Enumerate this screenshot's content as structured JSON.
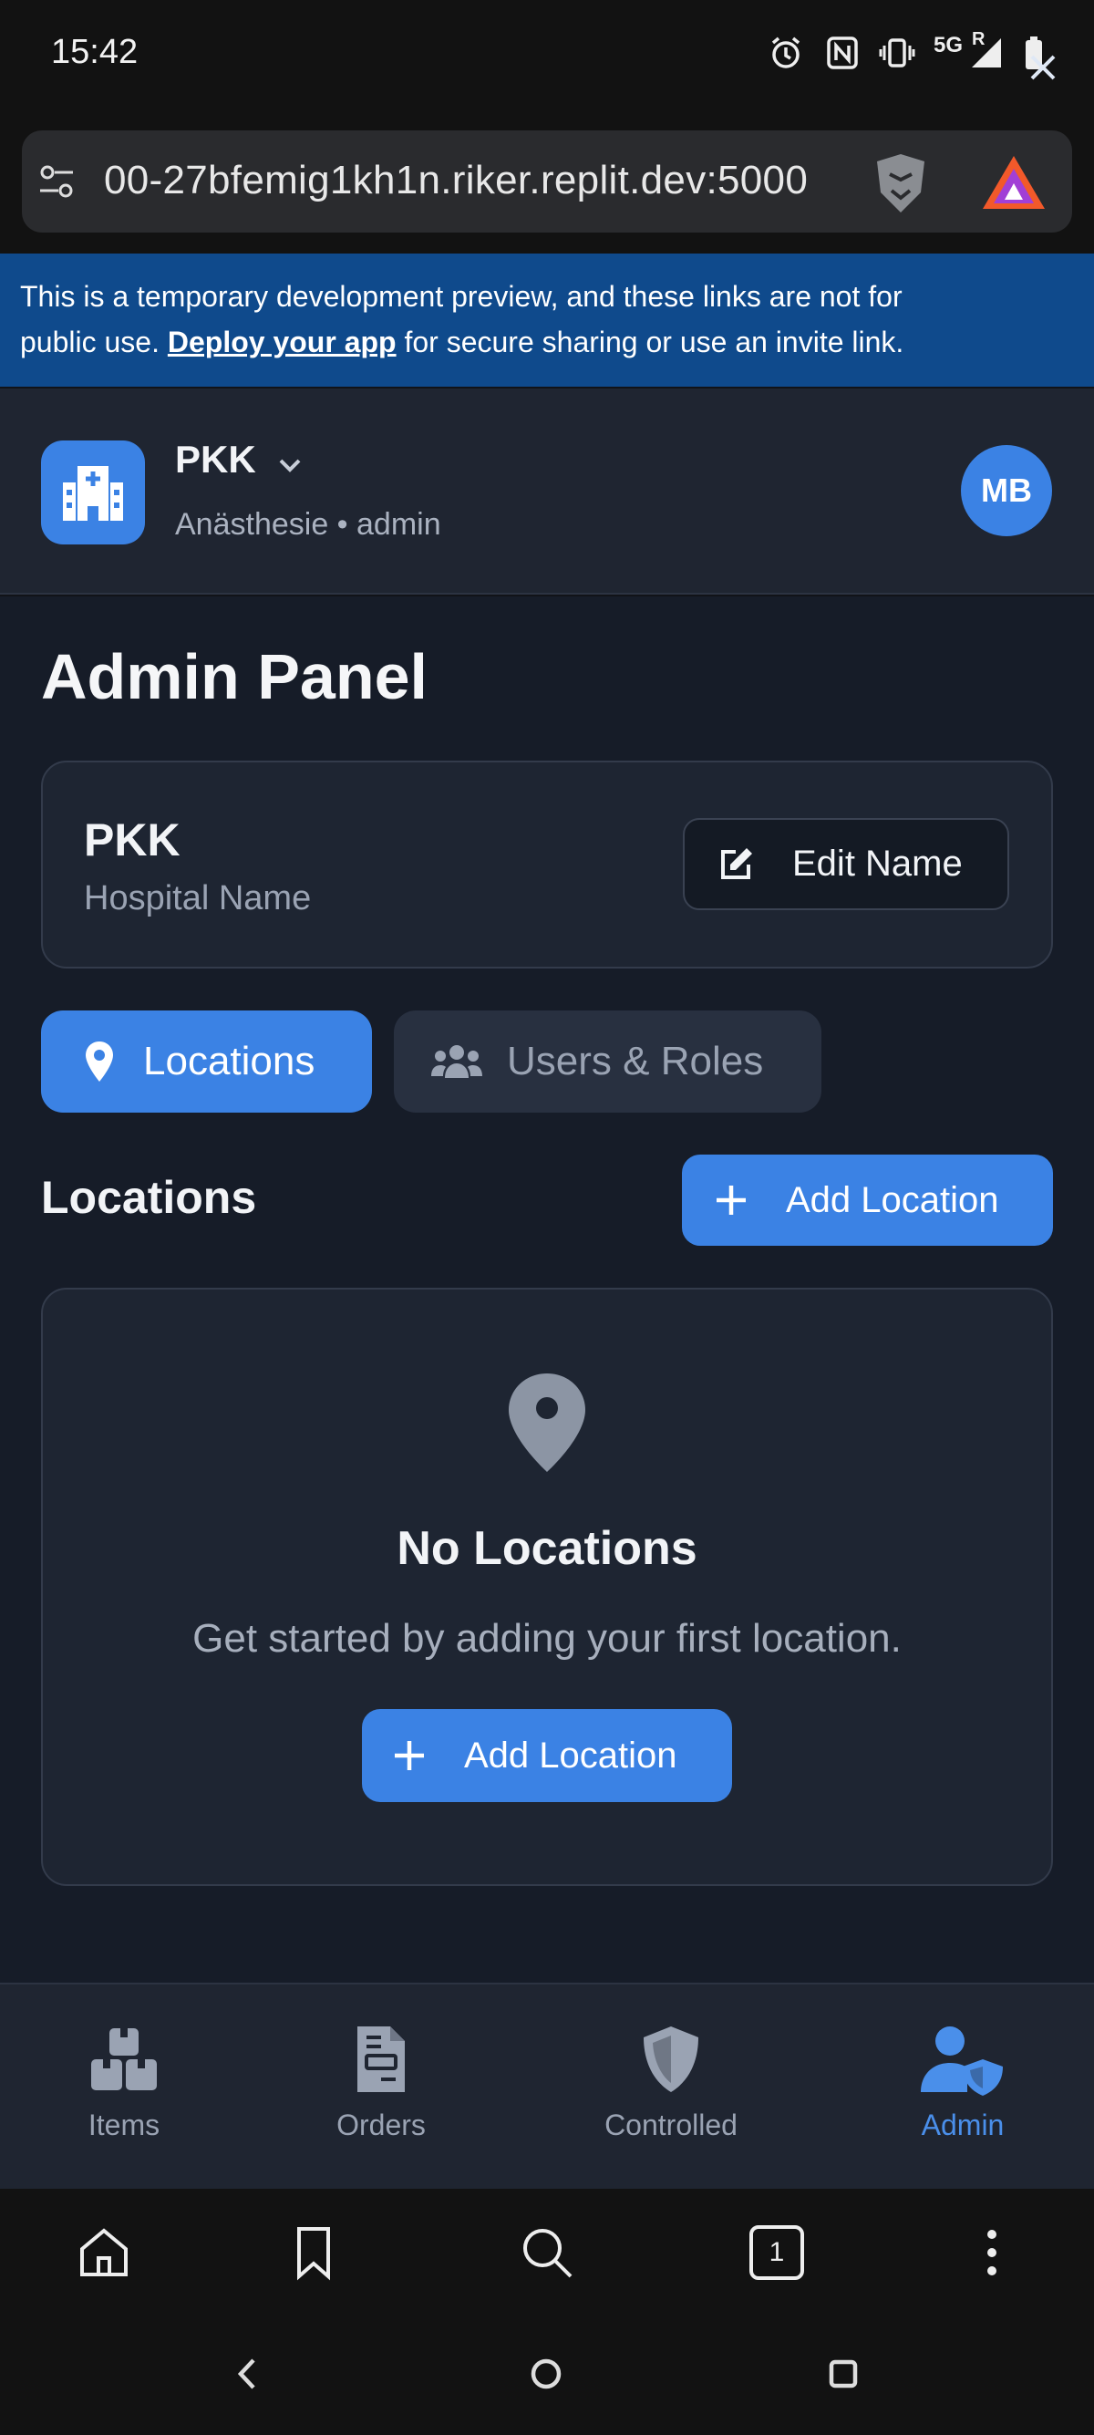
{
  "status_bar": {
    "time": "15:42",
    "network": "5G",
    "roaming": "R"
  },
  "browser": {
    "url": "00-27bfemig1kh1n.riker.replit.dev:5000"
  },
  "banner": {
    "text_before": "This is a temporary development preview, and these links are not for public use. ",
    "link_text": "Deploy your app",
    "text_after": " for secure sharing or use an invite link."
  },
  "header": {
    "hospital": "PKK",
    "subtitle": "Anästhesie • admin",
    "avatar_initials": "MB"
  },
  "page": {
    "title": "Admin Panel"
  },
  "hospital_card": {
    "name": "PKK",
    "label": "Hospital Name",
    "edit_label": "Edit Name"
  },
  "tabs": [
    {
      "label": "Locations",
      "icon": "map-pin-icon",
      "active": true
    },
    {
      "label": "Users & Roles",
      "icon": "users-icon",
      "active": false
    }
  ],
  "locations_section": {
    "title": "Locations",
    "add_label": "Add Location"
  },
  "empty_state": {
    "title": "No Locations",
    "description": "Get started by adding your first location.",
    "button_label": "Add Location"
  },
  "bottom_nav": [
    {
      "label": "Items",
      "icon": "boxes-icon",
      "active": false
    },
    {
      "label": "Orders",
      "icon": "file-invoice-icon",
      "active": false
    },
    {
      "label": "Controlled",
      "icon": "shield-icon",
      "active": false
    },
    {
      "label": "Admin",
      "icon": "user-shield-icon",
      "active": true
    }
  ],
  "browser_bottom": {
    "tab_count": "1"
  },
  "colors": {
    "accent": "#3b82e4",
    "background": "#161c28",
    "card": "#1e2532",
    "banner": "#0f4a8c"
  }
}
